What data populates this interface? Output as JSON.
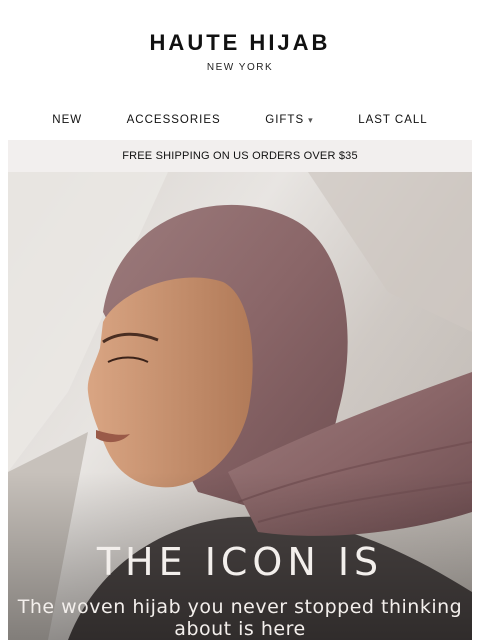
{
  "brand": {
    "name": "HAUTE HIJAB",
    "location": "NEW YORK"
  },
  "nav": {
    "items": [
      {
        "label": "NEW"
      },
      {
        "label": "ACCESSORIES"
      },
      {
        "label": "GIFTS",
        "icon": "chevron-down-icon"
      },
      {
        "label": "LAST CALL"
      }
    ]
  },
  "banner": {
    "text": "FREE SHIPPING ON US ORDERS OVER $35"
  },
  "hero": {
    "headline": "THE ICON IS",
    "subline": "The woven hijab you never stopped thinking about is here",
    "colors": {
      "scarf": "#8d6b6d",
      "skin": "#c48f6c",
      "backdrop": "#e4e0dc"
    }
  }
}
